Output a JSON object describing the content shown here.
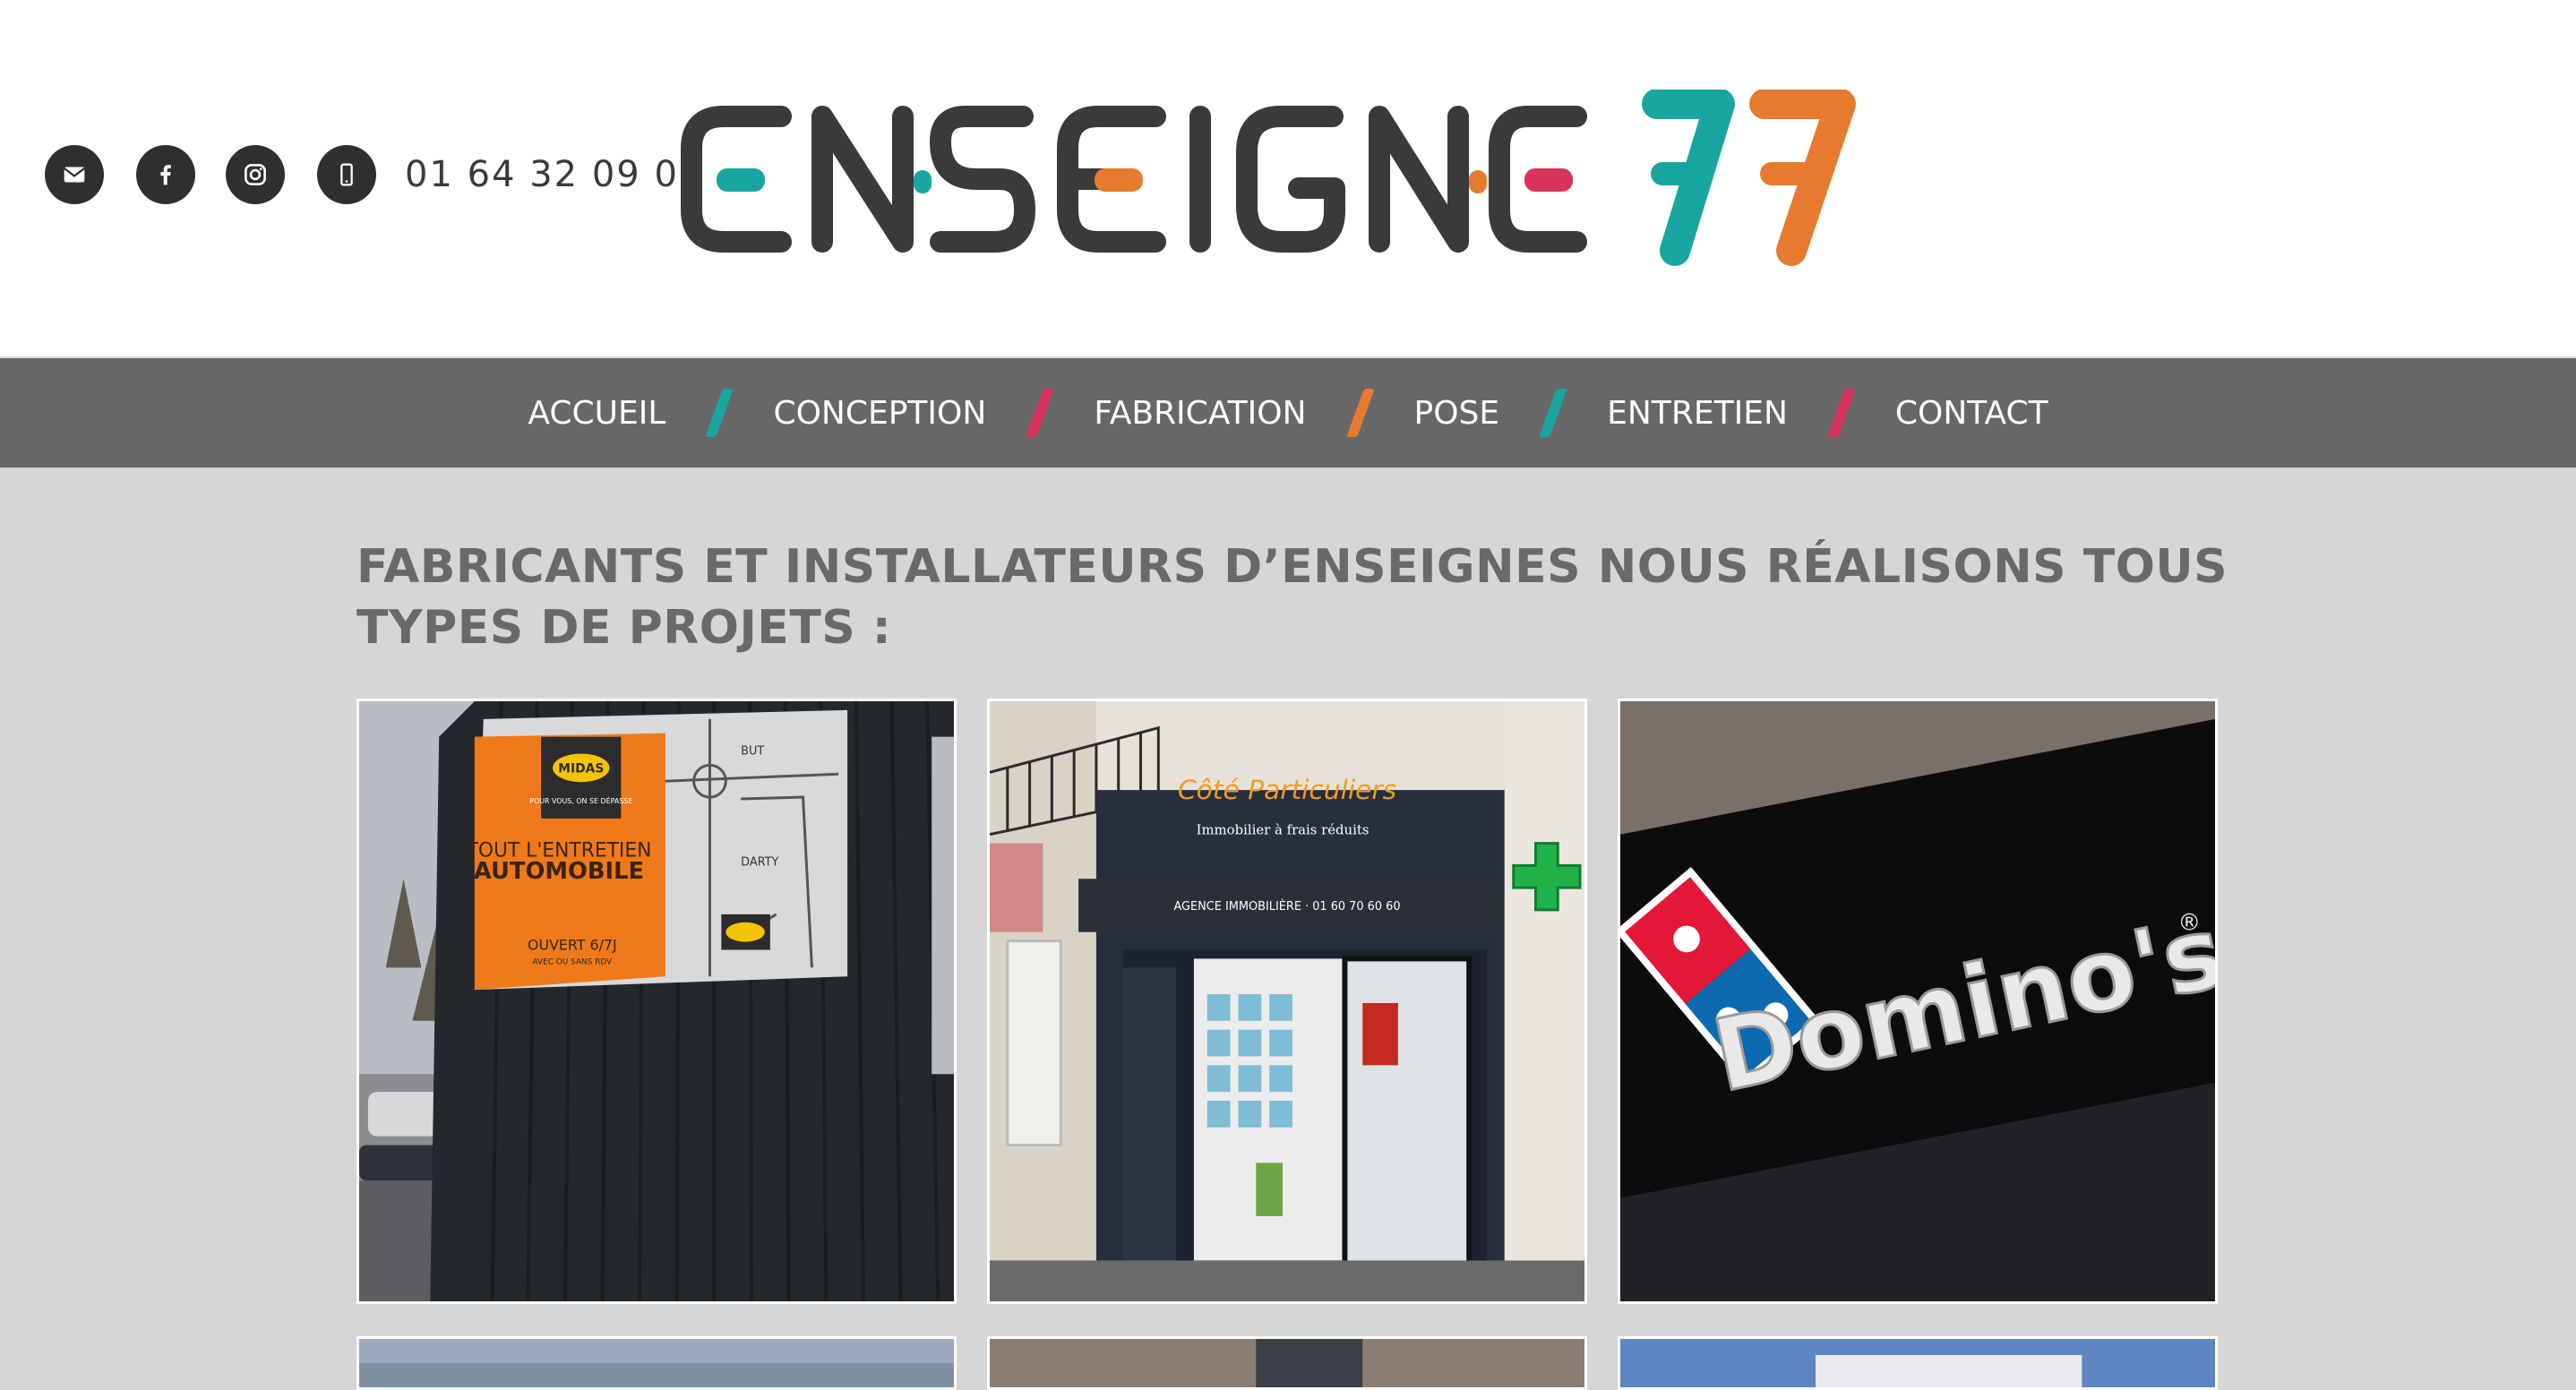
{
  "header": {
    "phone": "01 64 32 09 07",
    "social_icons": [
      "mail-icon",
      "facebook-icon",
      "instagram-icon",
      "phone-icon"
    ],
    "logo": {
      "text": "ENSEIGNE",
      "number": "77"
    }
  },
  "nav": {
    "items": [
      {
        "label": "ACCUEIL",
        "separator_color": "#1aa6a0"
      },
      {
        "label": "CONCEPTION",
        "separator_color": "#d8345a"
      },
      {
        "label": "FABRICATION",
        "separator_color": "#e67a2e"
      },
      {
        "label": "POSE",
        "separator_color": "#1aa6a0"
      },
      {
        "label": "ENTRETIEN",
        "separator_color": "#d8345a"
      },
      {
        "label": "CONTACT"
      }
    ]
  },
  "main": {
    "headline": "FABRICANTS ET INSTALLATEURS D’ENSEIGNES NOUS RÉALISONS TOUS TYPES DE PROJETS :",
    "gallery": [
      {
        "alt": "midas-sign-photo",
        "sign": {
          "brand": "MIDAS",
          "tagline": "POUR VOUS, ON SE DÉPASSE",
          "headline_1": "TOUT L'ENTRETIEN",
          "headline_2": "AUTOMOBILE",
          "hours": "OUVERT 6/7J",
          "hours_sub": "AVEC OU SANS RDV",
          "map_label_1": "BUT",
          "map_label_2": "DARTY"
        }
      },
      {
        "alt": "cote-particuliers-storefront-photo",
        "sign": {
          "brand": "Côté Particuliers",
          "tagline": "Immobilier à frais réduits",
          "agency": "AGENCE IMMOBILIÈRE · 01 60 70 60 60"
        }
      },
      {
        "alt": "dominos-sign-photo",
        "sign": {
          "brand": "Domino's",
          "mark": "®"
        }
      }
    ]
  },
  "colors": {
    "teal": "#1aa6a0",
    "orange": "#e67a2e",
    "pink": "#d8345a",
    "dark": "#3a3a3a",
    "nav_bg": "#676767",
    "page_bg": "#d6d6d6"
  }
}
